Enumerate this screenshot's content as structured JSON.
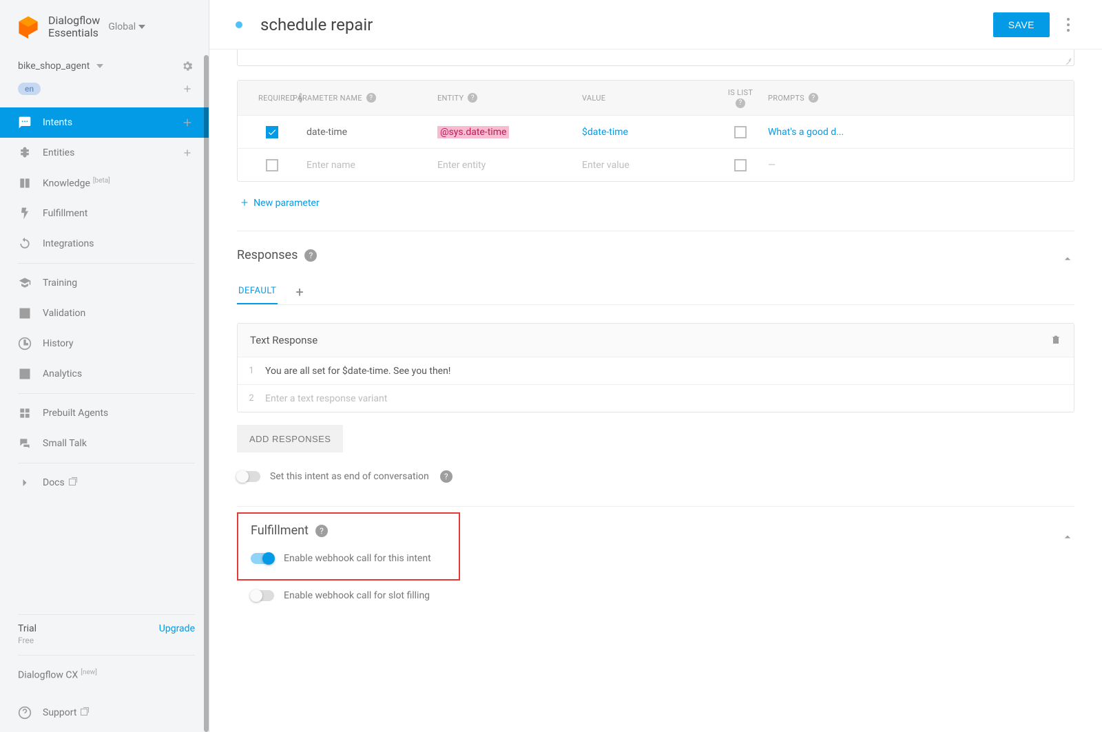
{
  "brand": {
    "line1": "Dialogflow",
    "line2": "Essentials",
    "scope": "Global"
  },
  "agent": {
    "name": "bike_shop_agent",
    "lang": "en"
  },
  "nav": {
    "intents": "Intents",
    "entities": "Entities",
    "knowledge": "Knowledge",
    "knowledge_badge": "[beta]",
    "fulfillment": "Fulfillment",
    "integrations": "Integrations",
    "training": "Training",
    "validation": "Validation",
    "history": "History",
    "analytics": "Analytics",
    "prebuilt": "Prebuilt Agents",
    "smalltalk": "Small Talk",
    "docs": "Docs"
  },
  "footer": {
    "trial": "Trial",
    "free": "Free",
    "upgrade": "Upgrade",
    "cx": "Dialogflow CX",
    "cx_badge": "[new]",
    "support": "Support"
  },
  "header": {
    "title": "schedule repair",
    "save": "SAVE"
  },
  "params": {
    "columns": {
      "required": "REQUIRED",
      "param": "PARAMETER NAME",
      "entity": "ENTITY",
      "value": "VALUE",
      "islist": "IS LIST",
      "prompts": "PROMPTS"
    },
    "rows": [
      {
        "required": true,
        "name": "date-time",
        "entity": "@sys.date-time",
        "value": "$date-time",
        "islist": false,
        "prompt": "What's a good d..."
      }
    ],
    "placeholders": {
      "name": "Enter name",
      "entity": "Enter entity",
      "value": "Enter value",
      "prompt": "—"
    },
    "new": "New parameter"
  },
  "responses": {
    "title": "Responses",
    "tab": "DEFAULT",
    "card_title": "Text Response",
    "rows": [
      {
        "n": "1",
        "text": "You are all set for $date-time. See you then!"
      },
      {
        "n": "2",
        "text": "Enter a text response variant",
        "placeholder": true
      }
    ],
    "add": "ADD RESPONSES",
    "end_toggle": "Set this intent as end of conversation"
  },
  "fulfillment": {
    "title": "Fulfillment",
    "enable_intent": "Enable webhook call for this intent",
    "enable_slot": "Enable webhook call for slot filling"
  }
}
